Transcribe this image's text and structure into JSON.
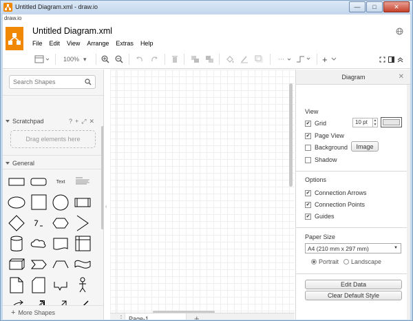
{
  "window": {
    "title": "Untitled Diagram.xml - draw.io",
    "minimize": "—",
    "maximize": "□",
    "close": "✕"
  },
  "app": {
    "label": "draw.io",
    "doc_title": "Untitled Diagram.xml",
    "brand_color": "#f08705"
  },
  "menu": [
    "File",
    "Edit",
    "View",
    "Arrange",
    "Extras",
    "Help"
  ],
  "toolbar": {
    "zoom": "100%",
    "zoom_arrow": "▾",
    "insert_plus": "+"
  },
  "sidebar": {
    "search_placeholder": "Search Shapes",
    "scratchpad": {
      "title": "Scratchpad",
      "icons": [
        "?",
        "+",
        "⤢",
        "✕"
      ],
      "dropzone": "Drag elements here"
    },
    "general": {
      "title": "General",
      "text_shape_label": "Text"
    },
    "more_shapes": "More Shapes"
  },
  "pages": {
    "menu_dots": "⋮",
    "tabs": [
      "Page-1"
    ],
    "add": "+"
  },
  "format_panel": {
    "title": "Diagram",
    "close": "✕",
    "view": {
      "heading": "View",
      "grid": {
        "label": "Grid",
        "checked": true,
        "size": "10 pt"
      },
      "page_view": {
        "label": "Page View",
        "checked": true
      },
      "background": {
        "label": "Background",
        "checked": false,
        "button": "Image"
      },
      "shadow": {
        "label": "Shadow",
        "checked": false
      }
    },
    "options": {
      "heading": "Options",
      "connection_arrows": {
        "label": "Connection Arrows",
        "checked": true
      },
      "connection_points": {
        "label": "Connection Points",
        "checked": true
      },
      "guides": {
        "label": "Guides",
        "checked": true
      }
    },
    "paper": {
      "heading": "Paper Size",
      "size": "A4 (210 mm x 297 mm)",
      "portrait": "Portrait",
      "landscape": "Landscape",
      "orientation": "portrait"
    },
    "edit_data": "Edit Data",
    "clear_default_style": "Clear Default Style"
  },
  "check_mark": "✔"
}
